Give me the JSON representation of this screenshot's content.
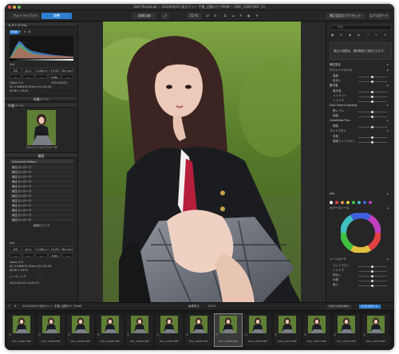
{
  "window": {
    "title": "DxO PhotoLab — 2024/08/25 地元サイト 手撮_近隣ロケフRAW — DNC_A5BIT.NEF (1)"
  },
  "toolbar": {
    "tab_library": "フォトライブラリ",
    "tab_customize": "調整",
    "btn_compare": "画像比較",
    "zoom_value": "22 %",
    "btn_export_settings": "補正設定のプリセット",
    "btn_export": "エクスポート"
  },
  "left_panel": {
    "histogram_title": "ヒストグラム",
    "histogram_tabs": [
      "RGB",
      "R",
      "G",
      "B"
    ],
    "exif_label": "Exif",
    "exif_values": [
      "ISO 200",
      "ƒ/1.4",
      "1/160 s",
      "+0 EV",
      "85 mm"
    ],
    "exif_buttons": [
      "—",
      "—",
      "—",
      "Auto",
      "—"
    ],
    "camera_line": "Nikon Z 8",
    "lens_line": "AF-S NIKKOR 85mm f/1.4G ED",
    "size_line": "8256 × 5504",
    "date_line": "2024/08/25",
    "preset_section": "作業ゾーン",
    "preview_section": "作業ゾーン",
    "preview_caption": "プロファイル/パラメータ",
    "history_section": "履歴",
    "history_header": "Advanced History",
    "history_items": [
      "補正ストローク",
      "補正ストローク",
      "補正ストローク",
      "補正ストローク",
      "補正ストローク",
      "補正ストローク",
      "補正ストローク",
      "補正ストローク",
      "補正ストローク",
      "補正ストローク",
      "補正ストローク",
      "補正ストローク"
    ],
    "history_footer": "画像をクリア",
    "exif2_label": "Exif",
    "exif2_values": [
      "ISO 200",
      "ƒ/1.4",
      "1/160 s",
      "+0 EV",
      "85 mm"
    ],
    "exif2_buttons": [
      "—",
      "—",
      "—",
      "Auto",
      "—"
    ],
    "camera2_line": "Nikon Z 8",
    "lens2_line": "AF-S NIKKOR 85mm f/1.4G ED",
    "size2_line": "8256 × 5504",
    "rating_label": "レーティング",
    "date2_line": "2024-08-25 14:09:22"
  },
  "right_panel": {
    "search_placeholder": "検索",
    "info_text": "補正の調整後、選択範囲に適用されます。",
    "sections": [
      "補正設定",
      "ホワイトバランス",
      "露光量",
      "DxO Smart Lighting",
      "ClearView Plus",
      "コントラスト",
      "カラーホイール",
      "トーンカーブ",
      "HSL"
    ],
    "slider_labels": [
      "温度",
      "色合い",
      "露光量",
      "ハイライト",
      "シャドウ",
      "黒レベル",
      "強度",
      "輝度",
      "彩度",
      "微細コントラスト",
      "コントラスト",
      "シャドウ",
      "明るい",
      "中間",
      "暗い"
    ]
  },
  "filmstrip": {
    "folder_path": "2024/08/25 地元サイト 手撮_近隣ロケフRAW",
    "count_label": "画像表示",
    "count_value": "1/215",
    "tab_film": "Film Collection",
    "tab_export": "エクスポート",
    "thumbs": [
      "DSC_A6062.NEF",
      "DSC_A6063.NEF",
      "DSC_A6064.NEF",
      "DSC_A6065.NEF",
      "DSC_A6066.NEF",
      "DSC_A6067.NEF",
      "DSC_A6068.NEF",
      "DSC_A6069.NEF",
      "DSC_A6070.NEF",
      "DSC_A6071.NEF",
      "DSC_A6072.NEF",
      "DSC_A6073.NEF",
      "DSC_A6074.NEF"
    ]
  },
  "colors": {
    "accent": "#2f7fd1",
    "panel": "#262626",
    "highlight": "#f0a030"
  }
}
